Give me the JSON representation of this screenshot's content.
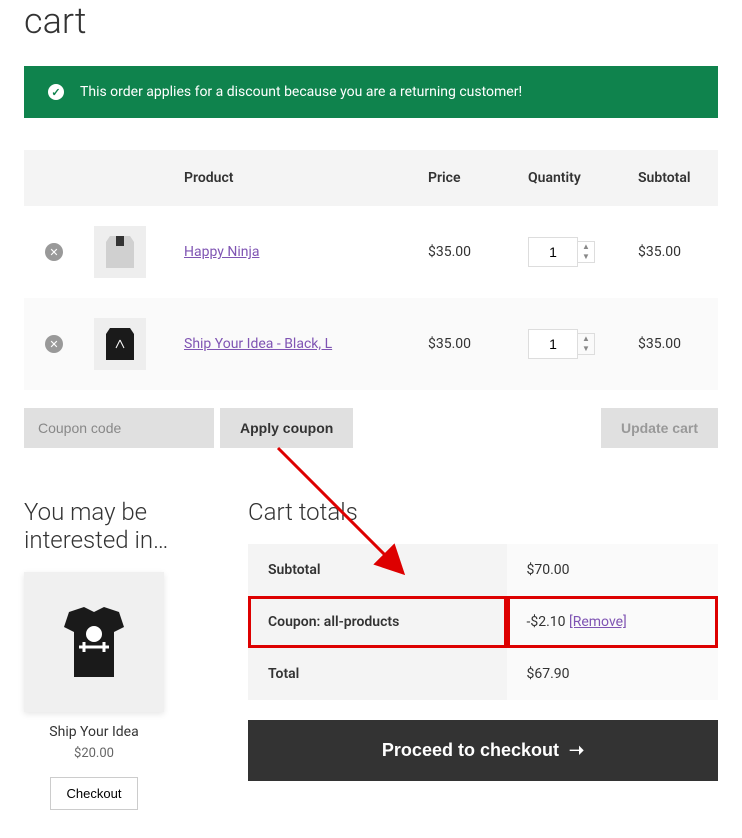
{
  "page": {
    "title": "cart"
  },
  "notice": {
    "text": "This order applies for a discount because you are a returning customer!"
  },
  "table": {
    "headers": {
      "product": "Product",
      "price": "Price",
      "quantity": "Quantity",
      "subtotal": "Subtotal"
    },
    "rows": [
      {
        "name": "Happy Ninja",
        "price": "$35.00",
        "qty": "1",
        "subtotal": "$35.00"
      },
      {
        "name": "Ship Your Idea - Black, L",
        "price": "$35.00",
        "qty": "1",
        "subtotal": "$35.00"
      }
    ]
  },
  "coupon": {
    "placeholder": "Coupon code",
    "apply": "Apply coupon"
  },
  "update": "Update cart",
  "upsell": {
    "title": "You may be interested in…",
    "name": "Ship Your Idea",
    "price": "$20.00",
    "button": "Checkout"
  },
  "totals": {
    "title": "Cart totals",
    "subtotal_label": "Subtotal",
    "subtotal_value": "$70.00",
    "coupon_label": "Coupon: all-products",
    "coupon_value": "-$2.10 ",
    "coupon_remove": "[Remove]",
    "total_label": "Total",
    "total_value": "$67.90"
  },
  "checkout": "Proceed to checkout"
}
